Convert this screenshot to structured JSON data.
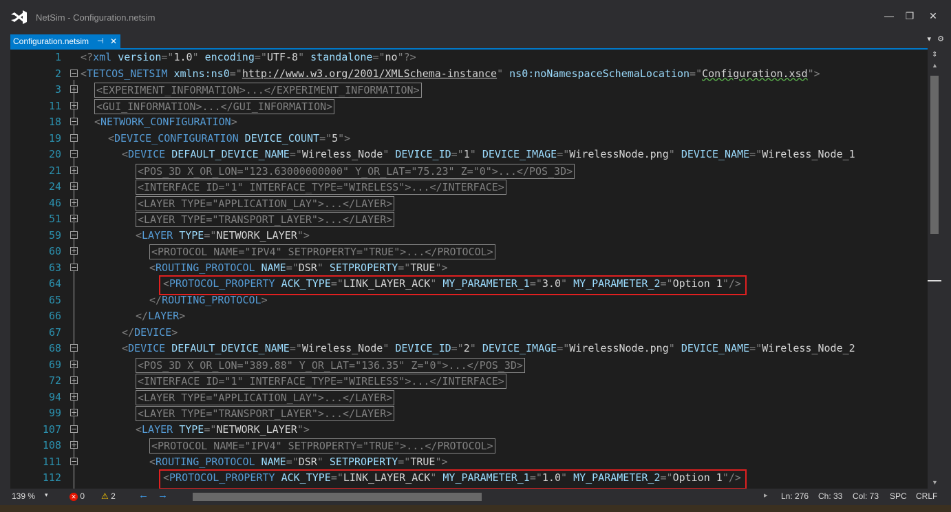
{
  "window": {
    "title": "NetSim - Configuration.netsim",
    "minimize": "—",
    "restore": "❐",
    "close": "✕"
  },
  "tab": {
    "label": "Configuration.netsim",
    "pin": "⊣",
    "close": "✕"
  },
  "lines": [
    {
      "num": "1",
      "fold": "",
      "indent": 0,
      "collapsed": false,
      "parts": [
        [
          "p",
          "<?"
        ],
        [
          "t",
          "xml "
        ],
        [
          "a",
          "version"
        ],
        [
          "p",
          "=\""
        ],
        [
          "v",
          "1.0"
        ],
        [
          "p",
          "\" "
        ],
        [
          "a",
          "encoding"
        ],
        [
          "p",
          "=\""
        ],
        [
          "v",
          "UTF-8"
        ],
        [
          "p",
          "\" "
        ],
        [
          "a",
          "standalone"
        ],
        [
          "p",
          "=\""
        ],
        [
          "v",
          "no"
        ],
        [
          "p",
          "\"?>"
        ]
      ]
    },
    {
      "num": "2",
      "fold": "−",
      "indent": 0,
      "collapsed": false,
      "parts": [
        [
          "p",
          "<"
        ],
        [
          "t",
          "TETCOS_NETSIM"
        ],
        [
          "a",
          " xmlns:ns0"
        ],
        [
          "p",
          "=\""
        ],
        [
          "u",
          "http://www.w3.org/2001/XMLSchema-instance"
        ],
        [
          "p",
          "\" "
        ],
        [
          "a",
          "ns0:noNamespaceSchemaLocation"
        ],
        [
          "p",
          "=\""
        ],
        [
          "sq",
          "Configuration.xsd"
        ],
        [
          "p",
          "\">"
        ]
      ]
    },
    {
      "num": "3",
      "fold": "+",
      "indent": 1,
      "collapsed": true,
      "parts": [
        [
          "g",
          "<EXPERIMENT_INFORMATION>...</EXPERIMENT_INFORMATION>"
        ]
      ]
    },
    {
      "num": "11",
      "fold": "+",
      "indent": 1,
      "collapsed": true,
      "parts": [
        [
          "g",
          "<GUI_INFORMATION>...</GUI_INFORMATION>"
        ]
      ]
    },
    {
      "num": "18",
      "fold": "−",
      "indent": 1,
      "collapsed": false,
      "parts": [
        [
          "p",
          "<"
        ],
        [
          "t",
          "NETWORK_CONFIGURATION"
        ],
        [
          "p",
          ">"
        ]
      ]
    },
    {
      "num": "19",
      "fold": "−",
      "indent": 2,
      "collapsed": false,
      "parts": [
        [
          "p",
          "<"
        ],
        [
          "t",
          "DEVICE_CONFIGURATION"
        ],
        [
          "a",
          " DEVICE_COUNT"
        ],
        [
          "p",
          "=\""
        ],
        [
          "v",
          "5"
        ],
        [
          "p",
          "\">"
        ]
      ]
    },
    {
      "num": "20",
      "fold": "−",
      "indent": 3,
      "collapsed": false,
      "parts": [
        [
          "p",
          "<"
        ],
        [
          "t",
          "DEVICE"
        ],
        [
          "a",
          " DEFAULT_DEVICE_NAME"
        ],
        [
          "p",
          "=\""
        ],
        [
          "v",
          "Wireless_Node"
        ],
        [
          "p",
          "\" "
        ],
        [
          "a",
          "DEVICE_ID"
        ],
        [
          "p",
          "=\""
        ],
        [
          "v",
          "1"
        ],
        [
          "p",
          "\" "
        ],
        [
          "a",
          "DEVICE_IMAGE"
        ],
        [
          "p",
          "=\""
        ],
        [
          "v",
          "WirelessNode.png"
        ],
        [
          "p",
          "\" "
        ],
        [
          "a",
          "DEVICE_NAME"
        ],
        [
          "p",
          "=\""
        ],
        [
          "v",
          "Wireless_Node_1"
        ]
      ]
    },
    {
      "num": "21",
      "fold": "+",
      "indent": 4,
      "collapsed": true,
      "parts": [
        [
          "g",
          "<POS_3D X_OR_LON=\"123.63000000000\" Y_OR_LAT=\"75.23\" Z=\"0\">...</POS_3D>"
        ]
      ]
    },
    {
      "num": "24",
      "fold": "+",
      "indent": 4,
      "collapsed": true,
      "parts": [
        [
          "g",
          "<INTERFACE ID=\"1\" INTERFACE_TYPE=\"WIRELESS\">...</INTERFACE>"
        ]
      ]
    },
    {
      "num": "46",
      "fold": "+",
      "indent": 4,
      "collapsed": true,
      "parts": [
        [
          "g",
          "<LAYER TYPE=\"APPLICATION_LAY\">...</LAYER>"
        ]
      ]
    },
    {
      "num": "51",
      "fold": "+",
      "indent": 4,
      "collapsed": true,
      "parts": [
        [
          "g",
          "<LAYER TYPE=\"TRANSPORT_LAYER\">...</LAYER>"
        ]
      ]
    },
    {
      "num": "59",
      "fold": "−",
      "indent": 4,
      "collapsed": false,
      "parts": [
        [
          "p",
          "<"
        ],
        [
          "t",
          "LAYER"
        ],
        [
          "a",
          " TYPE"
        ],
        [
          "p",
          "=\""
        ],
        [
          "v",
          "NETWORK_LAYER"
        ],
        [
          "p",
          "\">"
        ]
      ]
    },
    {
      "num": "60",
      "fold": "+",
      "indent": 5,
      "collapsed": true,
      "parts": [
        [
          "g",
          "<PROTOCOL NAME=\"IPV4\" SETPROPERTY=\"TRUE\">...</PROTOCOL>"
        ]
      ]
    },
    {
      "num": "63",
      "fold": "−",
      "indent": 5,
      "collapsed": false,
      "parts": [
        [
          "p",
          "<"
        ],
        [
          "t",
          "ROUTING_PROTOCOL"
        ],
        [
          "a",
          " NAME"
        ],
        [
          "p",
          "=\""
        ],
        [
          "v",
          "DSR"
        ],
        [
          "p",
          "\" "
        ],
        [
          "a",
          "SETPROPERTY"
        ],
        [
          "p",
          "=\""
        ],
        [
          "v",
          "TRUE"
        ],
        [
          "p",
          "\">"
        ]
      ]
    },
    {
      "num": "64",
      "fold": "",
      "indent": 6,
      "collapsed": false,
      "highlight": true,
      "parts": [
        [
          "p",
          "<"
        ],
        [
          "t",
          "PROTOCOL_PROPERTY"
        ],
        [
          "a",
          " ACK_TYPE"
        ],
        [
          "p",
          "=\""
        ],
        [
          "v",
          "LINK_LAYER_ACK"
        ],
        [
          "p",
          "\" "
        ],
        [
          "a",
          "MY_PARAMETER_1"
        ],
        [
          "p",
          "=\""
        ],
        [
          "v",
          "3.0"
        ],
        [
          "p",
          "\" "
        ],
        [
          "a",
          "MY_PARAMETER_2"
        ],
        [
          "p",
          "=\""
        ],
        [
          "v",
          "Option 1"
        ],
        [
          "p",
          "\"/>"
        ]
      ]
    },
    {
      "num": "65",
      "fold": "",
      "indent": 5,
      "collapsed": false,
      "parts": [
        [
          "p",
          "</"
        ],
        [
          "t",
          "ROUTING_PROTOCOL"
        ],
        [
          "p",
          ">"
        ]
      ]
    },
    {
      "num": "66",
      "fold": "",
      "indent": 4,
      "collapsed": false,
      "parts": [
        [
          "p",
          "</"
        ],
        [
          "t",
          "LAYER"
        ],
        [
          "p",
          ">"
        ]
      ]
    },
    {
      "num": "67",
      "fold": "",
      "indent": 3,
      "collapsed": false,
      "parts": [
        [
          "p",
          "</"
        ],
        [
          "t",
          "DEVICE"
        ],
        [
          "p",
          ">"
        ]
      ]
    },
    {
      "num": "68",
      "fold": "−",
      "indent": 3,
      "collapsed": false,
      "parts": [
        [
          "p",
          "<"
        ],
        [
          "t",
          "DEVICE"
        ],
        [
          "a",
          " DEFAULT_DEVICE_NAME"
        ],
        [
          "p",
          "=\""
        ],
        [
          "v",
          "Wireless_Node"
        ],
        [
          "p",
          "\" "
        ],
        [
          "a",
          "DEVICE_ID"
        ],
        [
          "p",
          "=\""
        ],
        [
          "v",
          "2"
        ],
        [
          "p",
          "\" "
        ],
        [
          "a",
          "DEVICE_IMAGE"
        ],
        [
          "p",
          "=\""
        ],
        [
          "v",
          "WirelessNode.png"
        ],
        [
          "p",
          "\" "
        ],
        [
          "a",
          "DEVICE_NAME"
        ],
        [
          "p",
          "=\""
        ],
        [
          "v",
          "Wireless_Node_2"
        ]
      ]
    },
    {
      "num": "69",
      "fold": "+",
      "indent": 4,
      "collapsed": true,
      "parts": [
        [
          "g",
          "<POS_3D X_OR_LON=\"389.88\" Y_OR_LAT=\"136.35\" Z=\"0\">...</POS_3D>"
        ]
      ]
    },
    {
      "num": "72",
      "fold": "+",
      "indent": 4,
      "collapsed": true,
      "parts": [
        [
          "g",
          "<INTERFACE ID=\"1\" INTERFACE_TYPE=\"WIRELESS\">...</INTERFACE>"
        ]
      ]
    },
    {
      "num": "94",
      "fold": "+",
      "indent": 4,
      "collapsed": true,
      "parts": [
        [
          "g",
          "<LAYER TYPE=\"APPLICATION_LAY\">...</LAYER>"
        ]
      ]
    },
    {
      "num": "99",
      "fold": "+",
      "indent": 4,
      "collapsed": true,
      "parts": [
        [
          "g",
          "<LAYER TYPE=\"TRANSPORT_LAYER\">...</LAYER>"
        ]
      ]
    },
    {
      "num": "107",
      "fold": "−",
      "indent": 4,
      "collapsed": false,
      "parts": [
        [
          "p",
          "<"
        ],
        [
          "t",
          "LAYER"
        ],
        [
          "a",
          " TYPE"
        ],
        [
          "p",
          "=\""
        ],
        [
          "v",
          "NETWORK_LAYER"
        ],
        [
          "p",
          "\">"
        ]
      ]
    },
    {
      "num": "108",
      "fold": "+",
      "indent": 5,
      "collapsed": true,
      "parts": [
        [
          "g",
          "<PROTOCOL NAME=\"IPV4\" SETPROPERTY=\"TRUE\">...</PROTOCOL>"
        ]
      ]
    },
    {
      "num": "111",
      "fold": "−",
      "indent": 5,
      "collapsed": false,
      "parts": [
        [
          "p",
          "<"
        ],
        [
          "t",
          "ROUTING_PROTOCOL"
        ],
        [
          "a",
          " NAME"
        ],
        [
          "p",
          "=\""
        ],
        [
          "v",
          "DSR"
        ],
        [
          "p",
          "\" "
        ],
        [
          "a",
          "SETPROPERTY"
        ],
        [
          "p",
          "=\""
        ],
        [
          "v",
          "TRUE"
        ],
        [
          "p",
          "\">"
        ]
      ]
    },
    {
      "num": "112",
      "fold": "",
      "indent": 6,
      "collapsed": false,
      "highlight": true,
      "parts": [
        [
          "p",
          "<"
        ],
        [
          "t",
          "PROTOCOL_PROPERTY"
        ],
        [
          "a",
          " ACK_TYPE"
        ],
        [
          "p",
          "=\""
        ],
        [
          "v",
          "LINK_LAYER_ACK"
        ],
        [
          "p",
          "\" "
        ],
        [
          "a",
          "MY_PARAMETER_1"
        ],
        [
          "p",
          "=\""
        ],
        [
          "v",
          "1.0"
        ],
        [
          "p",
          "\" "
        ],
        [
          "a",
          "MY_PARAMETER_2"
        ],
        [
          "p",
          "=\""
        ],
        [
          "v",
          "Option 1"
        ],
        [
          "p",
          "\"/>"
        ]
      ]
    }
  ],
  "status": {
    "zoom": "139 %",
    "errors": "0",
    "warnings": "2",
    "back": "←",
    "forward": "→",
    "scroll_right": "▸",
    "ln": "Ln: 276",
    "ch": "Ch: 33",
    "col": "Col: 73",
    "spc": "SPC",
    "crlf": "CRLF"
  },
  "colors": {
    "accent": "#007acc",
    "highlight_box": "#e02020",
    "tag": "#569cd6",
    "attr": "#9cdcfe"
  }
}
